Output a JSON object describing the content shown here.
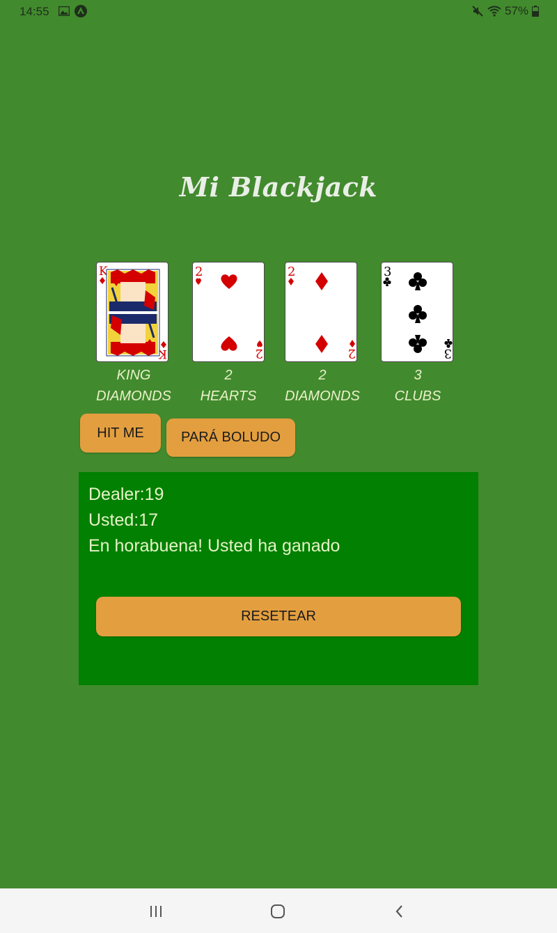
{
  "status_bar": {
    "time": "14:55",
    "battery": "57%",
    "icons": [
      "image-icon",
      "app-notification-icon",
      "mute-icon",
      "wifi-icon",
      "battery-icon"
    ]
  },
  "app": {
    "title": "Mi Blackjack"
  },
  "cards": [
    {
      "rank": "KING",
      "suit": "DIAMONDS",
      "corner": "K",
      "color": "#d40000"
    },
    {
      "rank": "2",
      "suit": "HEARTS",
      "corner": "2",
      "color": "#d40000"
    },
    {
      "rank": "2",
      "suit": "DIAMONDS",
      "corner": "2",
      "color": "#d40000"
    },
    {
      "rank": "3",
      "suit": "CLUBS",
      "corner": "3",
      "color": "#000000"
    }
  ],
  "buttons": {
    "hit": "HIT ME",
    "stand": "PARÁ BOLUDO",
    "reset": "RESETEAR"
  },
  "result": {
    "dealer": "Dealer:19",
    "player": "Usted:17",
    "message": "En horabuena! Usted ha ganado"
  },
  "colors": {
    "background": "#428a2e",
    "panel": "#018001",
    "button": "#e39f3f",
    "label_text": "#e8f2c8"
  },
  "nav_bar": {
    "icons": [
      "recent-apps-icon",
      "home-icon",
      "back-icon"
    ]
  }
}
